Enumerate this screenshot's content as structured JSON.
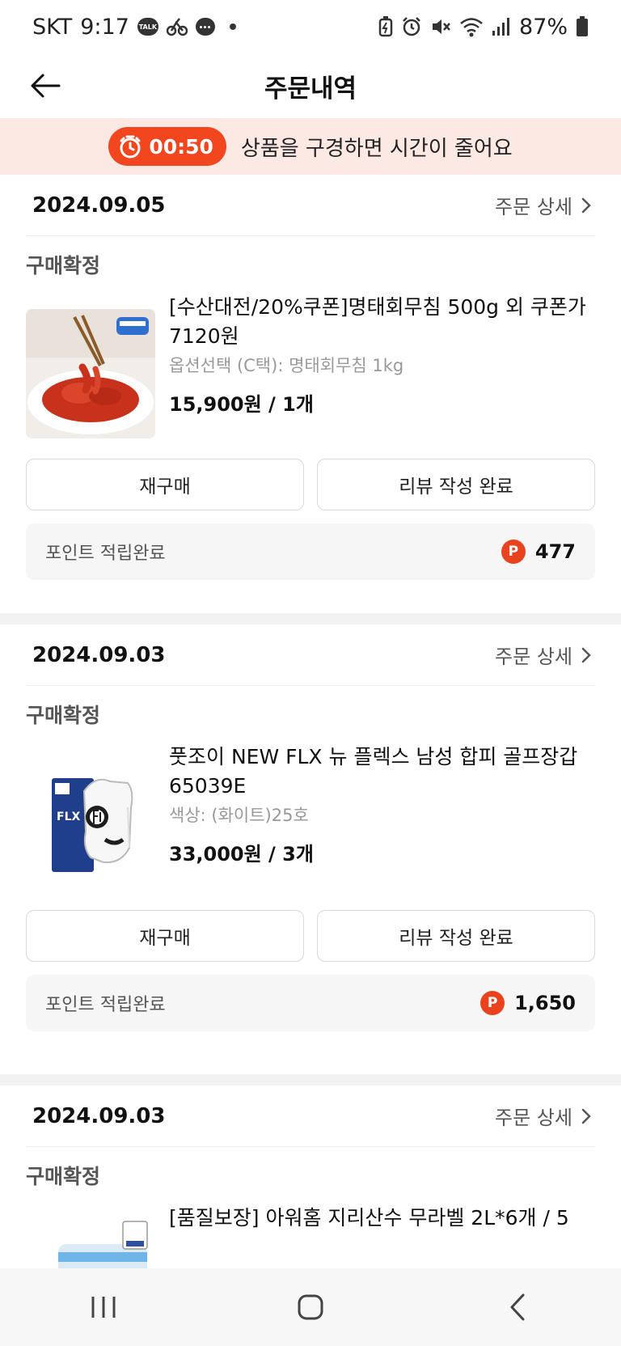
{
  "status_bar": {
    "carrier": "SKT",
    "time": "9:17",
    "talk_badge": "TALK",
    "battery": "87%",
    "icons": [
      "talk-icon",
      "bike-icon",
      "chat-icon",
      "dot-icon",
      "battery-saver-icon",
      "alarm-icon",
      "mute-icon",
      "wifi-icon",
      "signal-icon",
      "battery-icon"
    ]
  },
  "header": {
    "title": "주문내역",
    "back_icon": "back-arrow-icon"
  },
  "timer_banner": {
    "time": "00:50",
    "message": "상품을 구경하면 시간이 줄어요",
    "icon": "stopwatch-icon"
  },
  "orders": [
    {
      "date": "2024.09.05",
      "detail_label": "주문 상세",
      "status": "구매확정",
      "product": {
        "name": "[수산대전/20%쿠폰]명태회무침 500g 외 쿠폰가 7120원",
        "option": "옵션선택 (C택): 명태회무침 1kg",
        "price": "15,900원 / 1개"
      },
      "rebuy_label": "재구매",
      "review_label": "리뷰 작성 완료",
      "points_label": "포인트 적립완료",
      "points_icon_label": "P",
      "points_value": "477"
    },
    {
      "date": "2024.09.03",
      "detail_label": "주문 상세",
      "status": "구매확정",
      "product": {
        "name": "풋조이 NEW FLX 뉴 플렉스 남성 합피 골프장갑 65039E",
        "option": "색상: (화이트)25호",
        "price": "33,000원 / 3개",
        "thumb_text": "FLX"
      },
      "rebuy_label": "재구매",
      "review_label": "리뷰 작성 완료",
      "points_label": "포인트 적립완료",
      "points_icon_label": "P",
      "points_value": "1,650"
    },
    {
      "date": "2024.09.03",
      "detail_label": "주문 상세",
      "status": "구매확정",
      "product": {
        "name": "[품질보장] 아워홈 지리산수 무라벨 2L*6개 / 5"
      }
    }
  ],
  "nav_bar": {
    "icons": [
      "recent-apps-icon",
      "home-icon",
      "back-icon"
    ]
  },
  "colors": {
    "accent": "#f2461f",
    "banner_bg": "#fde9e4",
    "point_red": "#e8421e"
  }
}
